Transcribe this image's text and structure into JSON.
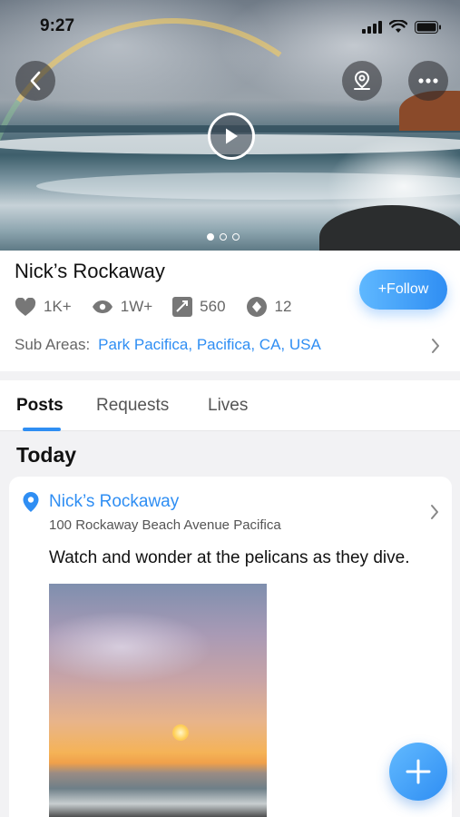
{
  "status_bar": {
    "time": "9:27"
  },
  "hero": {
    "dots": [
      true,
      false,
      false
    ]
  },
  "place": {
    "title": "Nick’s Rockaway",
    "follow_label": "+Follow",
    "stats": {
      "likes": "1K+",
      "views": "1W+",
      "posts": "560",
      "checkins": "12"
    },
    "subareas_label": "Sub Areas:",
    "subareas_value": "Park Pacifica, Pacifica, CA, USA"
  },
  "tabs": [
    {
      "label": "Posts",
      "active": true
    },
    {
      "label": "Requests",
      "active": false
    },
    {
      "label": "Lives",
      "active": false
    }
  ],
  "section_title": "Today",
  "post": {
    "location_name": "Nick’s Rockaway",
    "address": "100 Rockaway Beach Avenue Pacifica",
    "text": "Watch and wonder at the pelicans as they dive."
  },
  "colors": {
    "accent": "#2f8ef3",
    "follow_gradient_start": "#5fb8ff"
  },
  "icons": {
    "back": "chevron-left-icon",
    "map": "map-pin-icon",
    "more": "more-dots-icon",
    "play": "play-icon",
    "likes": "heart-icon",
    "views": "eye-icon",
    "posts": "post-icon",
    "checkins": "checkin-icon",
    "fab": "plus-icon"
  }
}
